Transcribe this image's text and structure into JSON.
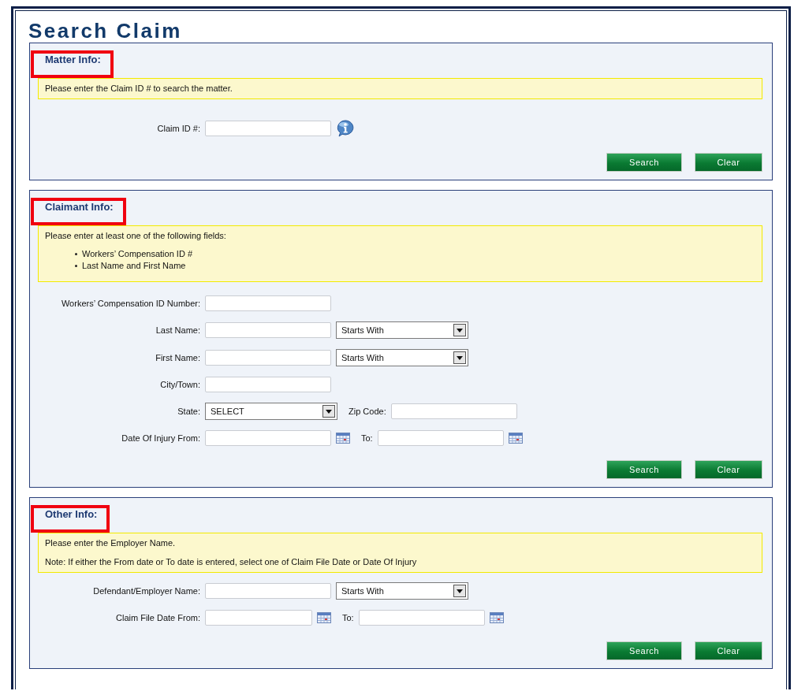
{
  "page": {
    "title": "Search Claim"
  },
  "sections": [
    {
      "heading": "Matter Info:",
      "highlighted": true,
      "notice": {
        "paragraphs": [
          "Please enter the Claim ID # to search the matter."
        ]
      },
      "rows": [
        {
          "label": "Claim ID #:",
          "controls": [
            {
              "kind": "text"
            },
            {
              "kind": "info"
            }
          ]
        }
      ],
      "buttons": [
        "Search",
        "Clear"
      ]
    },
    {
      "heading": "Claimant Info:",
      "highlighted": true,
      "notice": {
        "paragraphs": [
          "Please enter at least one of the following fields:"
        ],
        "bullets": [
          "Workers’ Compensation ID #",
          "Last Name and First Name"
        ]
      },
      "rows": [
        {
          "label": "Workers’ Compensation ID Number:",
          "controls": [
            {
              "kind": "text"
            }
          ]
        },
        {
          "label": "Last Name:",
          "controls": [
            {
              "kind": "text"
            },
            {
              "kind": "select",
              "value": "Starts With"
            }
          ]
        },
        {
          "label": "First Name:",
          "controls": [
            {
              "kind": "text"
            },
            {
              "kind": "select",
              "value": "Starts With"
            }
          ]
        },
        {
          "label": "City/Town:",
          "controls": [
            {
              "kind": "text"
            }
          ]
        },
        {
          "label": "State:",
          "controls": [
            {
              "kind": "select",
              "value": "SELECT"
            },
            {
              "kind": "label",
              "text": "Zip Code:"
            },
            {
              "kind": "text"
            }
          ]
        },
        {
          "label": "Date Of Injury From:",
          "controls": [
            {
              "kind": "date"
            },
            {
              "kind": "label",
              "text": "To:"
            },
            {
              "kind": "date"
            }
          ]
        }
      ],
      "buttons": [
        "Search",
        "Clear"
      ]
    },
    {
      "heading": "Other Info:",
      "highlighted": true,
      "notice": {
        "paragraphs": [
          "Please enter the Employer Name.",
          "Note: If either the From date or To date is entered, select one of Claim File Date or Date Of Injury"
        ]
      },
      "rows": [
        {
          "label": "Defendant/Employer  Name:",
          "controls": [
            {
              "kind": "text"
            },
            {
              "kind": "select",
              "value": "Starts With"
            }
          ]
        },
        {
          "label": "Claim File Date From:",
          "controls": [
            {
              "kind": "shortdate"
            },
            {
              "kind": "label",
              "text": "To:"
            },
            {
              "kind": "date"
            }
          ]
        }
      ],
      "buttons": [
        "Search",
        "Clear"
      ]
    }
  ]
}
